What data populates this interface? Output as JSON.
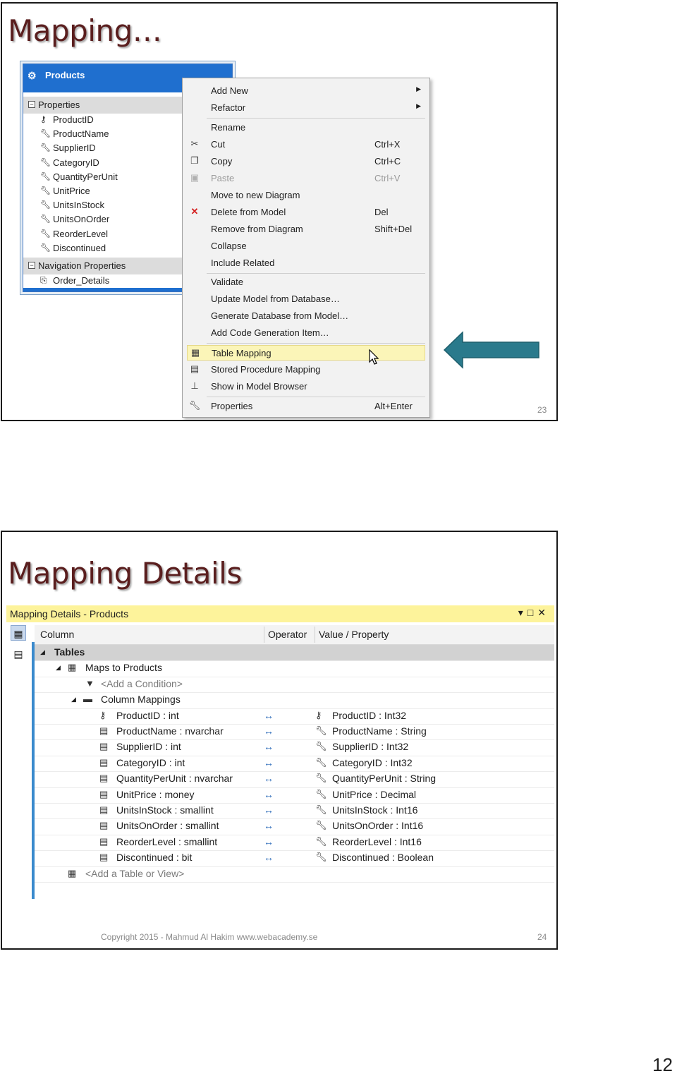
{
  "slide1": {
    "title": "Mapping…",
    "number": "23",
    "entity": {
      "name": "Products",
      "properties_label": "Properties",
      "properties": [
        "ProductID",
        "ProductName",
        "SupplierID",
        "CategoryID",
        "QuantityPerUnit",
        "UnitPrice",
        "UnitsInStock",
        "UnitsOnOrder",
        "ReorderLevel",
        "Discontinued"
      ],
      "nav_label": "Navigation Properties",
      "nav_properties": [
        "Order_Details"
      ]
    },
    "menu": {
      "add_new": "Add New",
      "refactor": "Refactor",
      "rename": "Rename",
      "cut": "Cut",
      "cut_sc": "Ctrl+X",
      "copy": "Copy",
      "copy_sc": "Ctrl+C",
      "paste": "Paste",
      "paste_sc": "Ctrl+V",
      "move": "Move to new Diagram",
      "delete": "Delete from Model",
      "delete_sc": "Del",
      "remove": "Remove from Diagram",
      "remove_sc": "Shift+Del",
      "collapse": "Collapse",
      "include": "Include Related",
      "validate": "Validate",
      "update": "Update Model from Database…",
      "generate": "Generate Database from Model…",
      "addcode": "Add Code Generation Item…",
      "table_mapping": "Table Mapping",
      "sp_mapping": "Stored Procedure Mapping",
      "show_browser": "Show in Model Browser",
      "properties": "Properties",
      "properties_sc": "Alt+Enter"
    },
    "arrow_color": "#2a7a8c"
  },
  "slide2": {
    "title": "Mapping Details",
    "number": "24",
    "copyright": "Copyright 2015 - Mahmud Al Hakim www.webacademy.se",
    "panel": {
      "title": "Mapping Details - Products",
      "col_column": "Column",
      "col_operator": "Operator",
      "col_value": "Value / Property",
      "tables": "Tables",
      "maps_to": "Maps to Products",
      "add_condition": "<Add a Condition>",
      "column_mappings": "Column Mappings",
      "operator_symbol": "↔",
      "mappings": [
        {
          "column": "ProductID : int",
          "property": "ProductID : Int32"
        },
        {
          "column": "ProductName : nvarchar",
          "property": "ProductName : String"
        },
        {
          "column": "SupplierID : int",
          "property": "SupplierID : Int32"
        },
        {
          "column": "CategoryID : int",
          "property": "CategoryID : Int32"
        },
        {
          "column": "QuantityPerUnit : nvarchar",
          "property": "QuantityPerUnit : String"
        },
        {
          "column": "UnitPrice : money",
          "property": "UnitPrice : Decimal"
        },
        {
          "column": "UnitsInStock : smallint",
          "property": "UnitsInStock : Int16"
        },
        {
          "column": "UnitsOnOrder : smallint",
          "property": "UnitsOnOrder : Int16"
        },
        {
          "column": "ReorderLevel : smallint",
          "property": "ReorderLevel : Int16"
        },
        {
          "column": "Discontinued : bit",
          "property": "Discontinued : Boolean"
        }
      ],
      "add_table": "<Add a Table or View>"
    }
  },
  "page_number": "12"
}
